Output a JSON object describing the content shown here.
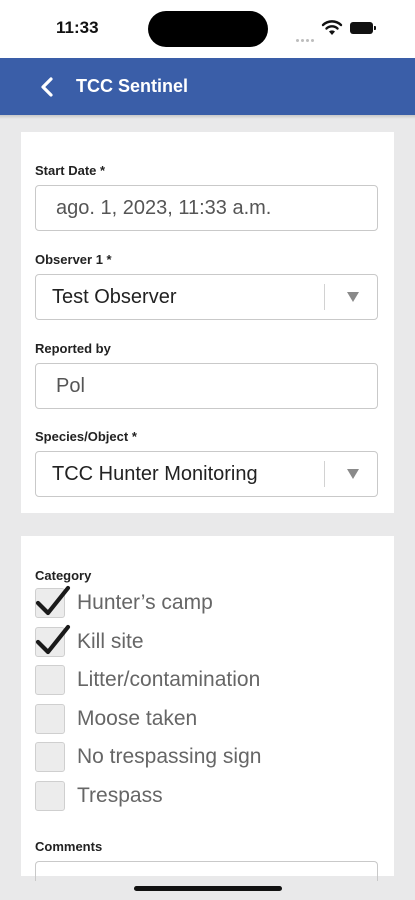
{
  "status_bar": {
    "time": "11:33",
    "icons": [
      "signal-dots-icon",
      "wifi-icon",
      "battery-icon"
    ]
  },
  "nav": {
    "title": "TCC Sentinel",
    "back_icon": "chevron-left-icon",
    "color": "#3a5ea8"
  },
  "form": {
    "start_date": {
      "label": "Start Date *",
      "value": "ago. 1, 2023, 11:33 a.m."
    },
    "observer": {
      "label": "Observer 1 *",
      "value": "Test Observer"
    },
    "reported_by": {
      "label": "Reported by",
      "value": "Pol"
    },
    "species": {
      "label": "Species/Object *",
      "value": "TCC Hunter Monitoring"
    }
  },
  "category": {
    "label": "Category",
    "options": [
      {
        "label": "Hunter’s camp",
        "checked": true
      },
      {
        "label": "Kill site",
        "checked": true
      },
      {
        "label": "Litter/contamination",
        "checked": false
      },
      {
        "label": "Moose taken",
        "checked": false
      },
      {
        "label": "No trespassing sign",
        "checked": false
      },
      {
        "label": "Trespass",
        "checked": false
      }
    ]
  },
  "comments": {
    "label": "Comments",
    "value": ""
  }
}
